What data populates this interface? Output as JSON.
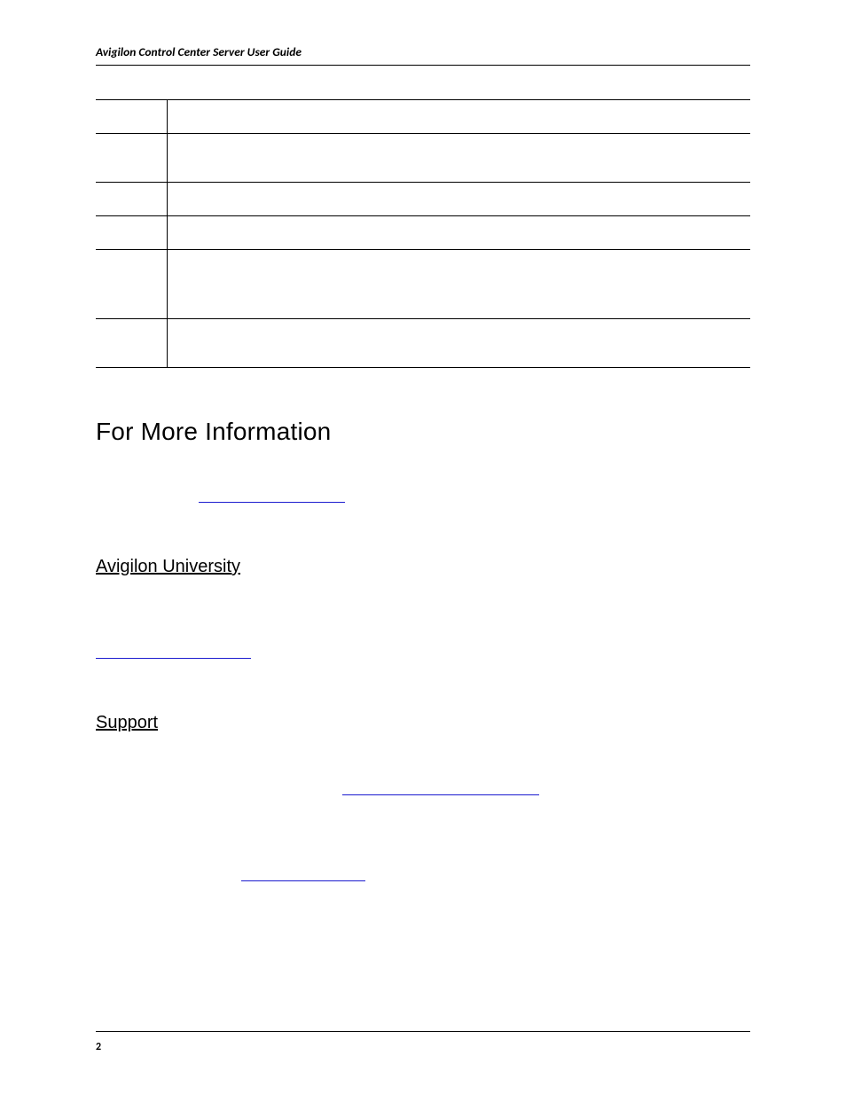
{
  "header": {
    "running_title": "Avigilon Control Center Server User Guide"
  },
  "table": {
    "rows": [
      {
        "height": "normal"
      },
      {
        "height": "tall"
      },
      {
        "height": "normal"
      },
      {
        "height": "normal"
      },
      {
        "height": "taller"
      },
      {
        "height": "tall"
      }
    ]
  },
  "sections": {
    "more_info": {
      "title": "For More Information",
      "link_text": ""
    },
    "university": {
      "title": "Avigilon University",
      "link_text": ""
    },
    "support": {
      "title": "Support",
      "link1_text": "",
      "link2_text": ""
    }
  },
  "footer": {
    "page_number": "2"
  }
}
